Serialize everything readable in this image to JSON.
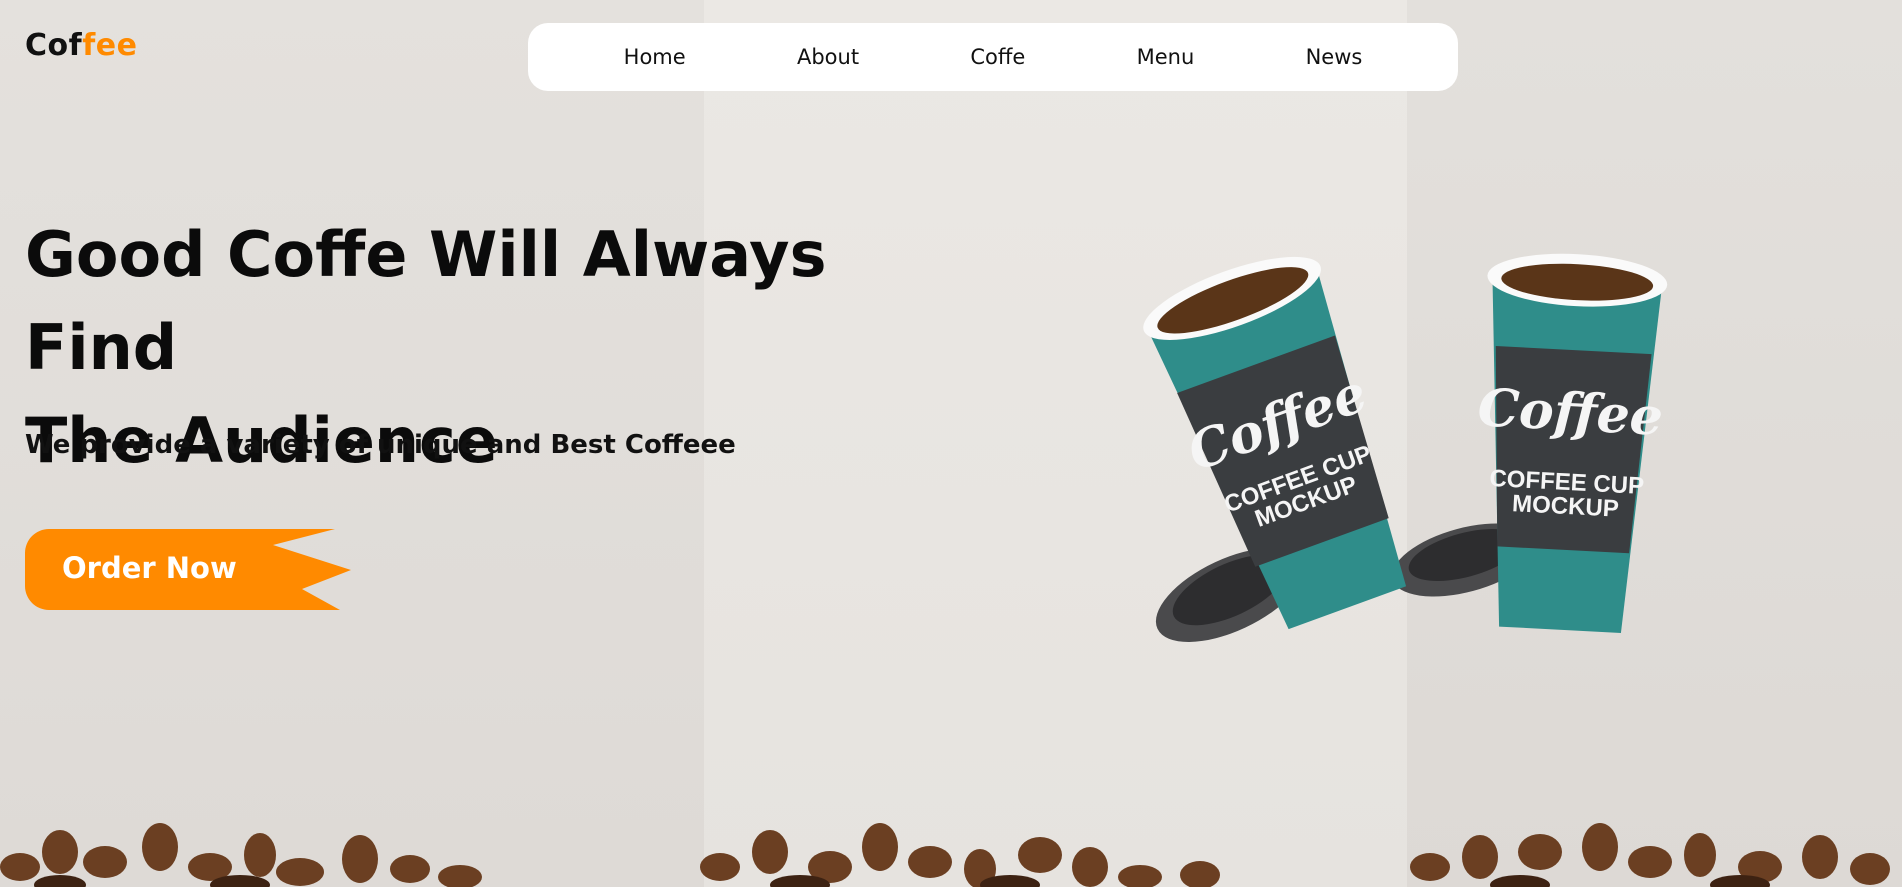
{
  "brand": {
    "part1": "Cof",
    "part2": "fee",
    "accent_color": "#ff8a00"
  },
  "nav": {
    "items": [
      "Home",
      "About",
      "Coffe",
      "Menu",
      "News"
    ]
  },
  "hero": {
    "headline_line1": "Good Coffe Will Always Find",
    "headline_line2": "The Audience",
    "subtitle": "We provide a variety of unique and Best Coffeee",
    "cta_label": "Order Now",
    "cta_color": "#ff8a00"
  },
  "product_image": {
    "cup_brand": "Coffee",
    "cup_caption_line1": "COFFEE CUP",
    "cup_caption_line2": "MOCKUP",
    "sleeve_color": "#3a3d40",
    "cup_color": "#2f8d8a"
  }
}
